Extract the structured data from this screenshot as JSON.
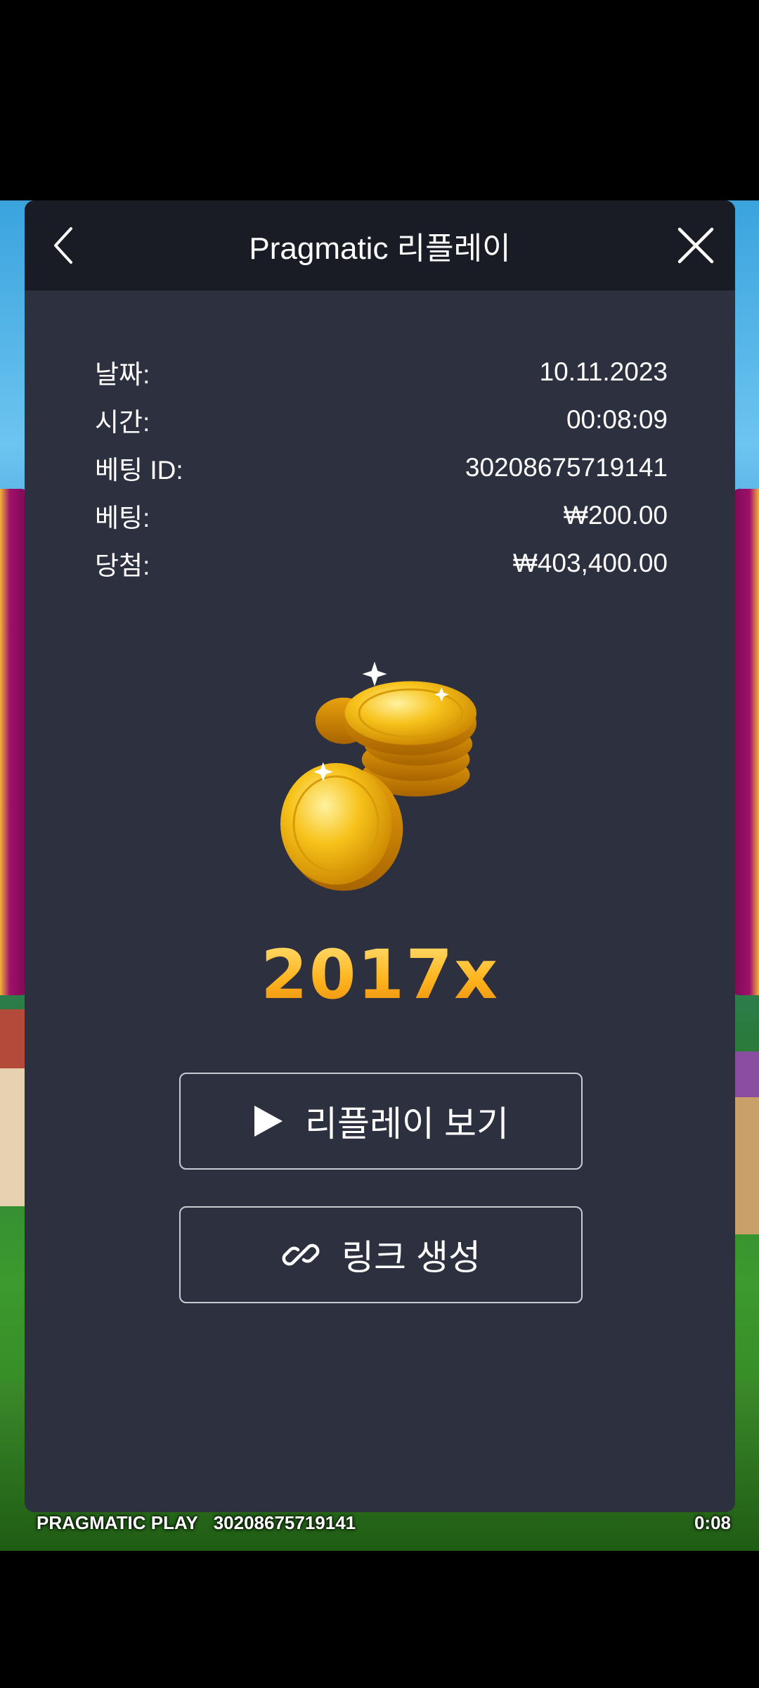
{
  "modal": {
    "title": "Pragmatic 리플레이",
    "back_icon": "chevron-left-icon",
    "close_icon": "close-icon"
  },
  "info": [
    {
      "key": "날짜:",
      "value": "10.11.2023"
    },
    {
      "key": "시간:",
      "value": "00:08:09"
    },
    {
      "key": "베팅 ID:",
      "value": "30208675719141"
    },
    {
      "key": "베팅:",
      "value": "₩200.00"
    },
    {
      "key": "당첨:",
      "value": "₩403,400.00"
    }
  ],
  "win": {
    "icon": "gold-coins-icon",
    "multiplier": "2017x"
  },
  "buttons": {
    "replay_label": "리플레이 보기",
    "replay_icon": "play-icon",
    "link_label": "링크 생성",
    "link_icon": "link-icon"
  },
  "game_footer": {
    "brand": "PRAGMATIC PLAY",
    "bet_id": "30208675719141",
    "time": "0:08"
  },
  "colors": {
    "modal_bg": "#2d303f",
    "header_bg": "#191b25",
    "accent_gold": "#ffb51f"
  }
}
